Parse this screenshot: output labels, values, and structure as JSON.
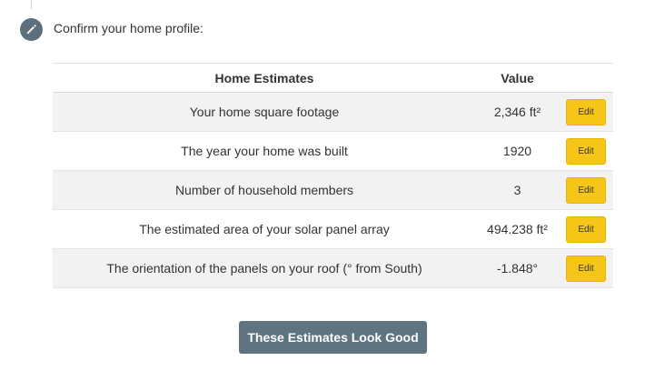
{
  "step": {
    "icon": "pencil-icon",
    "title": "Confirm your home profile:"
  },
  "table": {
    "headers": {
      "label": "Home Estimates",
      "value": "Value"
    },
    "rows": [
      {
        "label": "Your home square footage",
        "value": "2,346 ft²",
        "action": "Edit"
      },
      {
        "label": "The year your home was built",
        "value": "1920",
        "action": "Edit"
      },
      {
        "label": "Number of household members",
        "value": "3",
        "action": "Edit"
      },
      {
        "label": "The estimated area of your solar panel array",
        "value": "494.238 ft²",
        "action": "Edit"
      },
      {
        "label": "The orientation of the panels on your roof (° from South)",
        "value": "-1.848°",
        "action": "Edit"
      }
    ]
  },
  "confirm_button": "These Estimates Look Good",
  "colors": {
    "icon_bg": "#5c6f7b",
    "edit_button": "#f5c518",
    "confirm_button": "#5e7581",
    "row_shade": "#f2f2f2"
  }
}
